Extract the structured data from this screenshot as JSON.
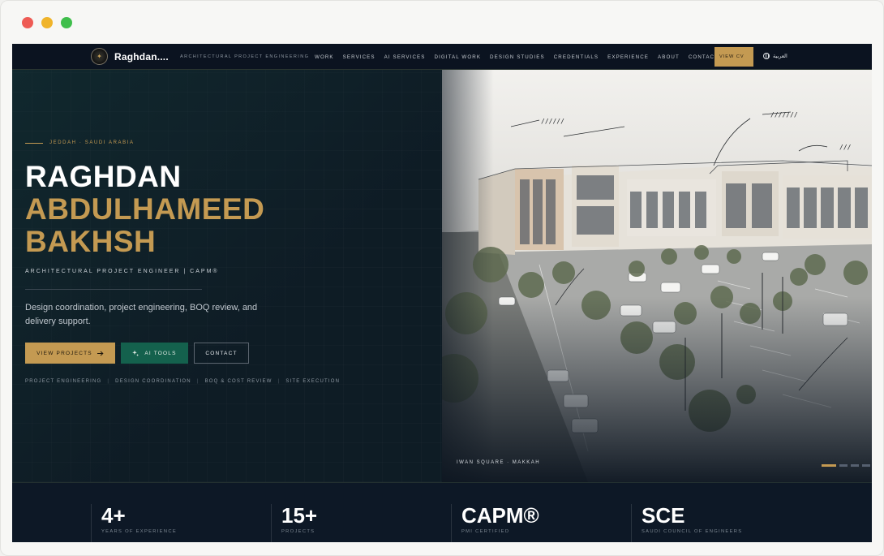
{
  "nav": {
    "logo": "Raghdan....",
    "tagline": "ARCHITECTURAL PROJECT ENGINEERING",
    "links": [
      "WORK",
      "SERVICES",
      "AI SERVICES",
      "DIGITAL WORK",
      "DESIGN STUDIES",
      "CREDENTIALS",
      "EXPERIENCE",
      "ABOUT",
      "CONTACT"
    ],
    "cv_button": "VIEW CV",
    "language": "العربية"
  },
  "hero": {
    "location": "JEDDAH · SAUDI ARABIA",
    "name_line1": "RAGHDAN",
    "name_line2": "ABDULHAMEED",
    "name_line3": "BAKHSH",
    "role": "ARCHITECTURAL PROJECT ENGINEER | CAPM®",
    "description": "Design coordination, project engineering, BOQ review, and delivery support.",
    "buttons": {
      "projects": "VIEW PROJECTS",
      "ai_tools": "AI TOOLS",
      "contact": "CONTACT"
    },
    "tags": [
      "PROJECT ENGINEERING",
      "DESIGN COORDINATION",
      "BOQ & COST REVIEW",
      "SITE EXECUTION"
    ],
    "image_caption": "IWAN SQUARE · MAKKAH",
    "slides_count": 4,
    "active_slide": 1
  },
  "stats": [
    {
      "value": "4+",
      "label": "YEARS OF EXPERIENCE"
    },
    {
      "value": "15+",
      "label": "PROJECTS"
    },
    {
      "value": "CAPM®",
      "label": "PMI CERTIFIED"
    },
    {
      "value": "SCE",
      "label": "SAUDI COUNCIL OF ENGINEERS"
    }
  ],
  "colors": {
    "accent_gold": "#c49a52",
    "accent_green": "#14614d",
    "background_dark": "#0c1520"
  }
}
